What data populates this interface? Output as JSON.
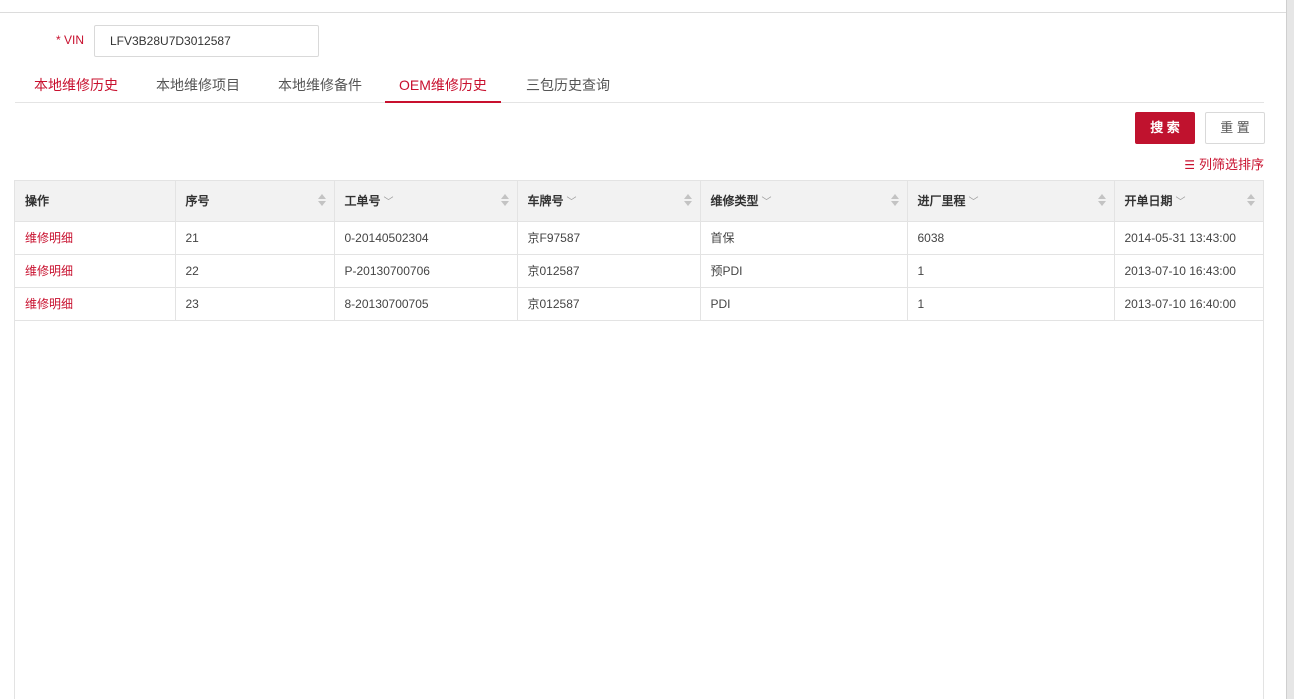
{
  "form": {
    "vin_label": "* VIN",
    "vin_value": "LFV3B28U7D3012587"
  },
  "tabs": [
    {
      "label": "本地维修历史"
    },
    {
      "label": "本地维修项目"
    },
    {
      "label": "本地维修备件"
    },
    {
      "label": "OEM维修历史"
    },
    {
      "label": "三包历史查询"
    }
  ],
  "buttons": {
    "search": "搜 索",
    "reset": "重 置"
  },
  "column_filter": {
    "icon": "sliders-icon",
    "label": "列筛选排序"
  },
  "table": {
    "columns": [
      {
        "label": "操作"
      },
      {
        "label": "序号"
      },
      {
        "label": "工单号"
      },
      {
        "label": "车牌号"
      },
      {
        "label": "维修类型"
      },
      {
        "label": "进厂里程"
      },
      {
        "label": "开单日期"
      }
    ],
    "rows": [
      {
        "action": "维修明细",
        "seq": "21",
        "order_no": "0-20140502304",
        "plate": "京F97587",
        "repair_type": "首保",
        "mileage": "6038",
        "open_date": "2014-05-31 13:43:00"
      },
      {
        "action": "维修明细",
        "seq": "22",
        "order_no": "P-20130700706",
        "plate": "京012587",
        "repair_type": "预PDI",
        "mileage": "1",
        "open_date": "2013-07-10 16:43:00"
      },
      {
        "action": "维修明细",
        "seq": "23",
        "order_no": "8-20130700705",
        "plate": "京012587",
        "repair_type": "PDI",
        "mileage": "1",
        "open_date": "2013-07-10 16:40:00"
      }
    ]
  },
  "colors": {
    "accent": "#c8102e",
    "header_bg": "#f2f2f2",
    "border": "#e3e3e3"
  }
}
